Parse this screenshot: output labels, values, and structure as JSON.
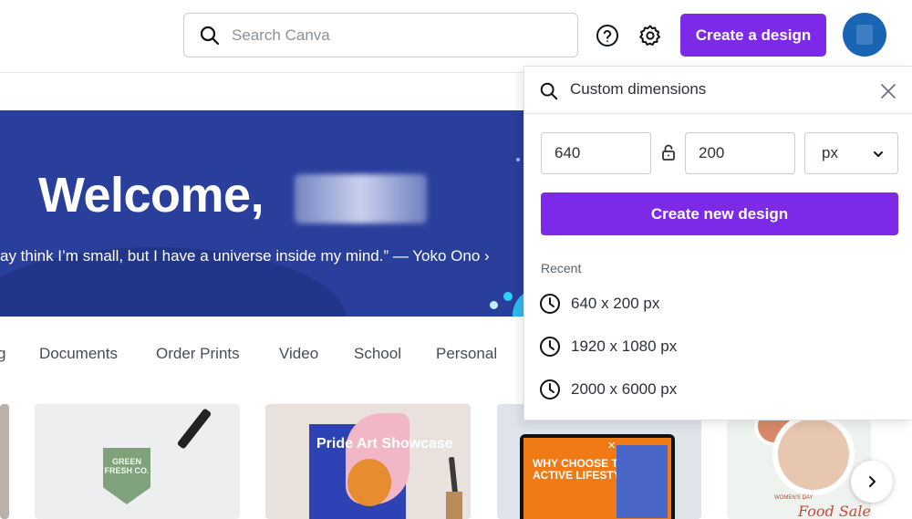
{
  "header": {
    "search_placeholder": "Search Canva",
    "create_button_label": "Create a design",
    "help_icon": "help-icon",
    "settings_icon": "gear-icon"
  },
  "banner": {
    "welcome_text": "Welcome,",
    "quote_text": "ay think I’m small, but I have a universe inside my mind.” — Yoko Ono ›"
  },
  "categories": [
    {
      "label": "g"
    },
    {
      "label": "Documents"
    },
    {
      "label": "Order Prints"
    },
    {
      "label": "Video"
    },
    {
      "label": "School"
    },
    {
      "label": "Personal"
    }
  ],
  "thumbnails": {
    "leaf_text": "GREEN FRESH CO.",
    "pride_title": "Pride Art Showcase",
    "why_text": "WHY CHOOSE THE ACTIVE LIFESTYLE",
    "food_text": "WOMEN'S DAY",
    "food_script": "Food Sale"
  },
  "dropdown": {
    "search_value": "Custom dimensions",
    "width_value": "640",
    "height_value": "200",
    "unit": "px",
    "create_button_label": "Create new design",
    "recent_label": "Recent",
    "recent_items": [
      {
        "label": "640 x 200 px"
      },
      {
        "label": "1920 x 1080 px"
      },
      {
        "label": "2000 x 6000 px"
      }
    ]
  },
  "colors": {
    "brand_purple": "#7d2ae8",
    "banner_blue": "#2a3f9c",
    "avatar_blue": "#1a64b4"
  }
}
